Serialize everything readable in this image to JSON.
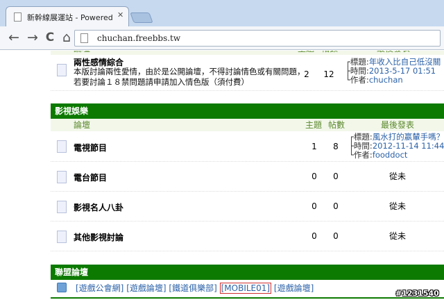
{
  "browser": {
    "tab_title": "新幹線展運站 - Powered by",
    "tab_close": "✕",
    "url": "chuchan.freebbs.tw",
    "back_glyph": "←",
    "forward_glyph": "→",
    "reload_glyph": "C",
    "home_glyph": "⌂"
  },
  "top_section": {
    "forum": {
      "name": "兩性感情綜合",
      "desc_line1": "本版討論兩性愛情，由於是公開論壇，不得討論情色或有關問題，",
      "desc_line2": "若要討論１８禁問題請申請加入情色版（須付費）",
      "topics": "2",
      "posts": "12",
      "last_title_key": "┌標題:",
      "last_title": "年收入比自己低沒關 ..",
      "last_time_key": "├時間:",
      "last_time": "2013-5-17 01:51",
      "last_author_key": "└作者:",
      "last_author": "chuchan"
    }
  },
  "category": {
    "title": "影視娛樂",
    "col_forum": "論壇",
    "col_topics": "主題",
    "col_posts": "帖數",
    "col_last": "最後發表",
    "forums": [
      {
        "name": "電視節目",
        "topics": "1",
        "posts": "8",
        "last_title_key": "┌標題:",
        "last_title": "風水打的嬴輦手嗎？",
        "last_time_key": "├時間:",
        "last_time": "2012-11-14 11:44",
        "last_author_key": "└作者:",
        "last_author": "fooddoct"
      },
      {
        "name": "電台節目",
        "topics": "0",
        "posts": "0",
        "never": "從未"
      },
      {
        "name": "影視名人八卦",
        "topics": "0",
        "posts": "0",
        "never": "從未"
      },
      {
        "name": "其他影視討論",
        "topics": "0",
        "posts": "0",
        "never": "從未"
      }
    ]
  },
  "league": {
    "title": "聯盟論壇",
    "links": [
      "[遊戲公會網]",
      "[遊戲論壇]",
      "[鐵道俱樂部]",
      "[MOBILE01]",
      "[遊戲論壇]"
    ]
  },
  "watermark": "#1231540",
  "colors": {
    "category_bar": "#0c7a00",
    "link": "#2c62a8",
    "column_header_text": "#5c8a2e",
    "highlight_box": "#d03030"
  }
}
